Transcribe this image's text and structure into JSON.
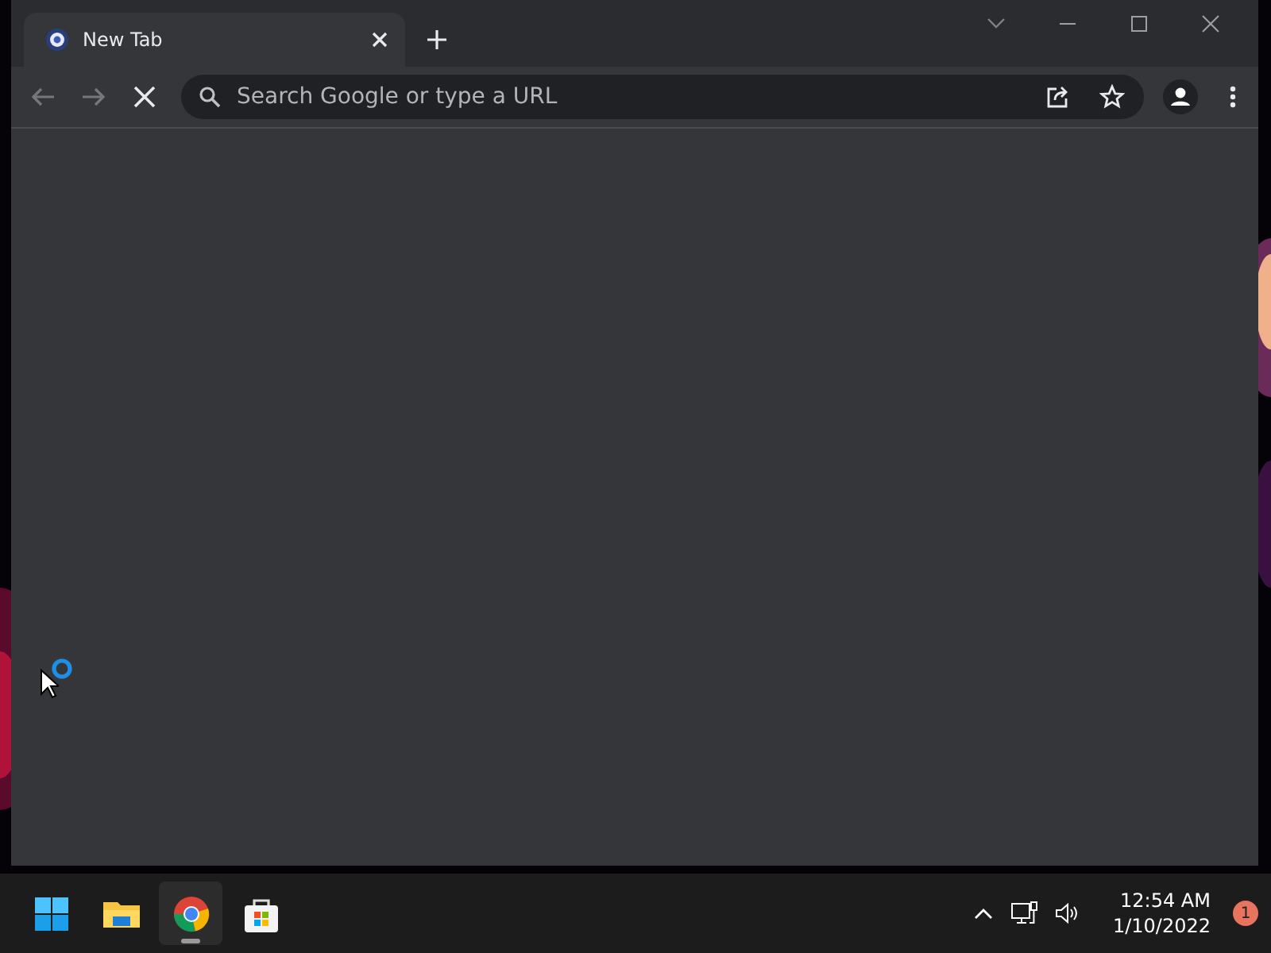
{
  "browser": {
    "tabs": [
      {
        "title": "New Tab",
        "selected": true
      }
    ],
    "nav": [
      {
        "kind": "back",
        "disabled": true
      },
      {
        "kind": "forward",
        "disabled": true
      }
    ],
    "loading": true,
    "omnibox": {
      "placeholder": "Search Google or type a URL"
    }
  },
  "taskbar": {
    "apps": [
      {
        "kind": "start",
        "active": false
      },
      {
        "kind": "files",
        "active": false
      },
      {
        "kind": "chrome",
        "active": true
      },
      {
        "kind": "store",
        "active": false
      }
    ],
    "clock": {
      "time": "12:54 AM",
      "date": "1/10/2022"
    },
    "notifications": "1"
  }
}
